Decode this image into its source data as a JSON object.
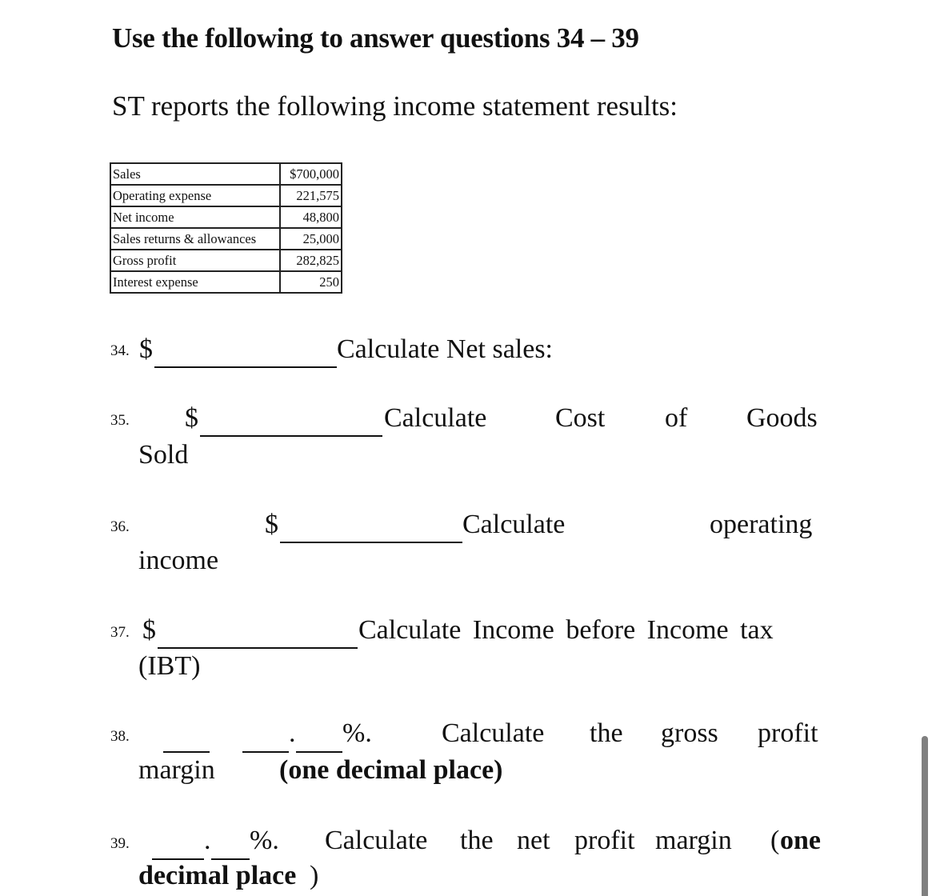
{
  "heading": "Use the following to answer questions 34 – 39",
  "intro": "ST reports the following income statement results:",
  "income_statement": [
    {
      "label": "Sales",
      "value": "$700,000"
    },
    {
      "label": "Operating expense",
      "value": "221,575"
    },
    {
      "label": "Net income",
      "value": "48,800"
    },
    {
      "label": "Sales returns & allowances",
      "value": "25,000"
    },
    {
      "label": "Gross profit",
      "value": "282,825"
    },
    {
      "label": "Interest expense",
      "value": "250"
    }
  ],
  "questions": [
    {
      "number": "34.",
      "prefix": "$",
      "line1": "Calculate Net sales:",
      "line2": ""
    },
    {
      "number": "35.",
      "prefix": "$",
      "line1_words": [
        "Calculate",
        "Cost",
        "of",
        "Goods"
      ],
      "line2": "Sold"
    },
    {
      "number": "36.",
      "prefix": "$",
      "line1_words": [
        "Calculate",
        "operating"
      ],
      "line2": "income"
    },
    {
      "number": "37.",
      "prefix": "$",
      "line1": "Calculate Income before Income tax",
      "line2": "(IBT)"
    },
    {
      "number": "38.",
      "dot": ".",
      "suffix": "%.",
      "line1_words": [
        "Calculate",
        "the",
        "gross",
        "profit"
      ],
      "line2": "margin",
      "line2_bold": "(one decimal place)"
    },
    {
      "number": "39.",
      "dot": ".",
      "suffix": "%.",
      "line1_words": [
        "Calculate",
        "the",
        "net",
        "profit",
        "margin",
        "("
      ],
      "line1_bold": "one",
      "line2_bold": "decimal place",
      "line2_end": ")"
    }
  ]
}
